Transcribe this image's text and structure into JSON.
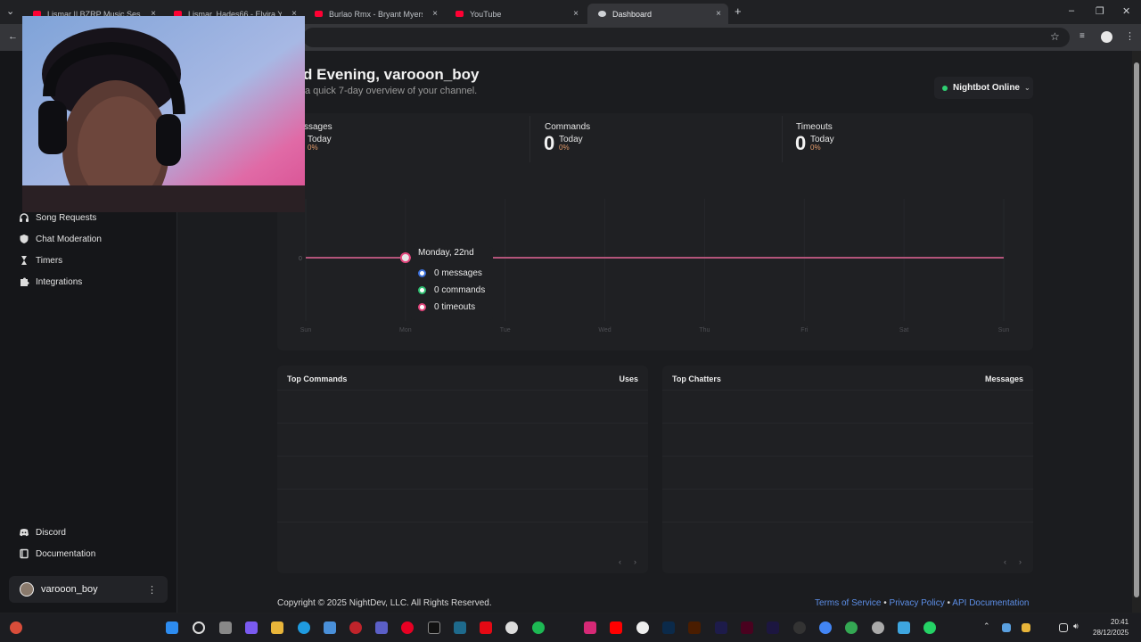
{
  "browser": {
    "tabs": [
      {
        "title": "Lismar || BZRP Music Sessions #",
        "active": false
      },
      {
        "title": "Lismar, Hades66 - Elvira Y Tony",
        "active": false
      },
      {
        "title": "Burlao Rmx - Bryant Myers x Ar",
        "active": false
      },
      {
        "title": "YouTube",
        "active": false
      },
      {
        "title": "Dashboard",
        "active": true
      }
    ],
    "new_tab": "+",
    "close_glyph": "×"
  },
  "sidebar": {
    "items": [
      {
        "label": "Song Requests",
        "icon": "headphones-icon"
      },
      {
        "label": "Chat Moderation",
        "icon": "shield-icon"
      },
      {
        "label": "Timers",
        "icon": "hourglass-icon"
      },
      {
        "label": "Integrations",
        "icon": "puzzle-icon"
      }
    ],
    "bottom": [
      {
        "label": "Discord",
        "icon": "discord-icon"
      },
      {
        "label": "Documentation",
        "icon": "book-icon"
      }
    ],
    "user": {
      "name": "varooon_boy",
      "menu": "⋮"
    }
  },
  "header": {
    "greeting": "d Evening, varooon_boy",
    "subtitle": "a quick 7-day overview of your channel.",
    "bot_status": "Nightbot Online"
  },
  "stats": [
    {
      "label": "ssages",
      "value": "",
      "today": "Today",
      "change": "0%"
    },
    {
      "label": "Commands",
      "value": "0",
      "today": "Today",
      "change": "0%"
    },
    {
      "label": "Timeouts",
      "value": "0",
      "today": "Today",
      "change": "0%"
    }
  ],
  "chart_data": {
    "type": "line",
    "categories": [
      "Sun",
      "Mon",
      "Tue",
      "Wed",
      "Thu",
      "Fri",
      "Sat",
      "Sun"
    ],
    "y_tick": "0",
    "series": [
      {
        "name": "messages",
        "values": [
          0,
          0,
          0,
          0,
          0,
          0,
          0,
          0
        ],
        "color": "#3b6fd8"
      },
      {
        "name": "commands",
        "values": [
          0,
          0,
          0,
          0,
          0,
          0,
          0,
          0
        ],
        "color": "#2fbf71"
      },
      {
        "name": "timeouts",
        "values": [
          0,
          0,
          0,
          0,
          0,
          0,
          0,
          0
        ],
        "color": "#e0457b"
      }
    ],
    "tooltip": {
      "date": "Monday, 22nd",
      "rows": [
        "0 messages",
        "0 commands",
        "0 timeouts"
      ]
    }
  },
  "tables": {
    "commands": {
      "title": "Top Commands",
      "column": "Uses"
    },
    "chatters": {
      "title": "Top Chatters",
      "column": "Messages"
    },
    "prev": "‹",
    "next": "›"
  },
  "footer": {
    "copyright": "Copyright © 2025 NightDev, LLC. All Rights Reserved.",
    "links": [
      "Terms of Service",
      "Privacy Policy",
      "API Documentation"
    ],
    "separator": " • "
  },
  "taskbar": {
    "time": "20:41",
    "date": "28/12/2025"
  },
  "colors": {
    "accent_pink": "#e0457b",
    "online_green": "#2fcf72",
    "link_blue": "#5c8ee6"
  }
}
